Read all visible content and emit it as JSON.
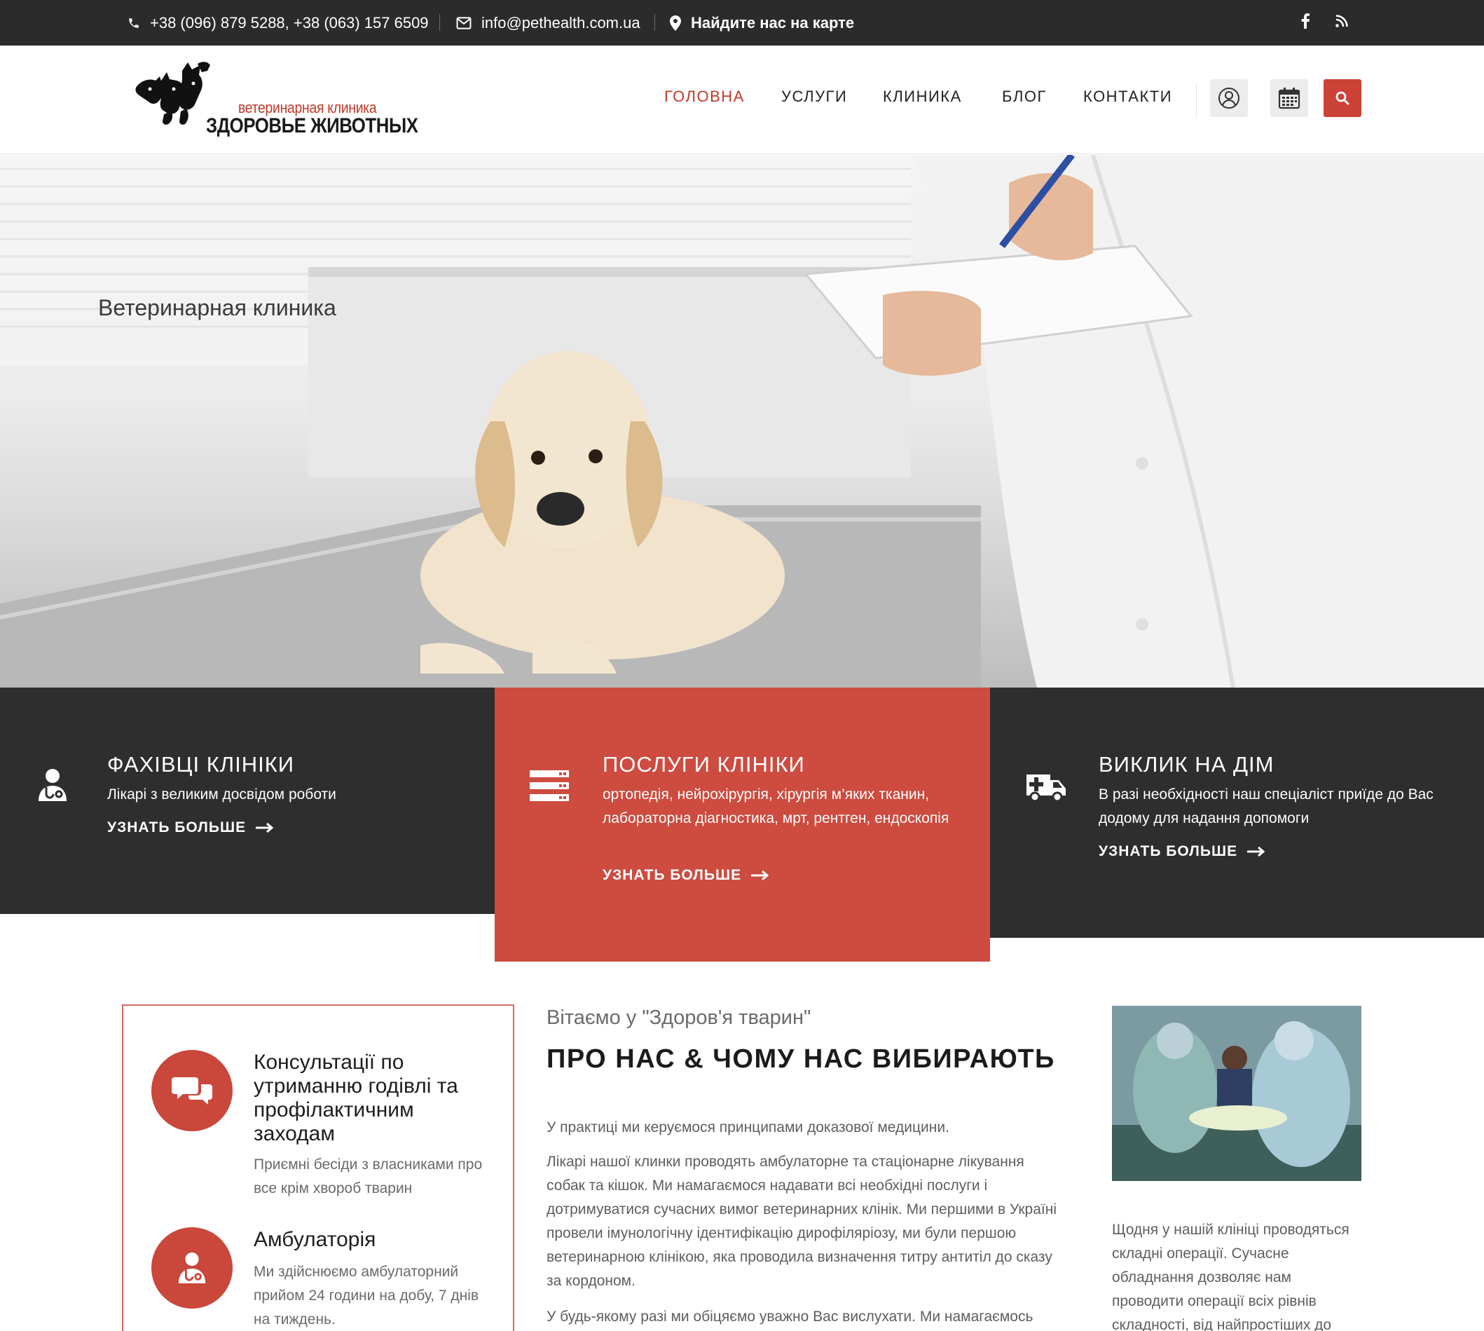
{
  "topbar": {
    "phones": "+38 (096) 879 5288, +38 (063) 157 6509",
    "email": "info@pethealth.com.ua",
    "map_link": "Найдите нас на карте",
    "social": [
      "facebook-icon",
      "rss-icon"
    ]
  },
  "header": {
    "logo_line1": "ветеринарная клиника",
    "logo_line2": "ЗДОРОВЬЕ ЖИВОТНЫХ",
    "nav": [
      "ГОЛОВНА",
      "УСЛУГИ",
      "КЛИНИКА",
      "БЛОГ",
      "КОНТАКТИ"
    ],
    "active_nav": "ГОЛОВНА",
    "buttons": [
      "user-icon",
      "calendar-icon",
      "search-icon"
    ]
  },
  "hero": {
    "title": "Ветеринарная клиника"
  },
  "features": [
    {
      "title": "ФАХІВЦІ КЛІНІКИ",
      "text": "Лікарі з великим досвідом роботи",
      "more": "УЗНАТЬ БОЛЬШЕ",
      "icon": "doctor-icon"
    },
    {
      "title": "ПОСЛУГИ КЛІНІКИ",
      "text": "ортопедія, нейрохірургія,  хірургія м’яких тканин, лабораторна діагностика, мрт, рентген, ендоскопія",
      "more": "УЗНАТЬ БОЛЬШЕ",
      "icon": "server-list-icon"
    },
    {
      "title": "ВИКЛИК НА ДІМ",
      "text": "В разі необхідності наш спеціаліст приїде до Вас додому для надання допомоги",
      "more": "УЗНАТЬ БОЛЬШЕ",
      "icon": "ambulance-icon"
    }
  ],
  "services": [
    {
      "title": "Консультації по утриманню годівлі та профілактичним заходам",
      "text": "Приємні бесіди з власниками про все крім хвороб тварин",
      "icon": "chat-bubbles-icon"
    },
    {
      "title": "Амбулаторія",
      "text": "Ми здійснюємо амбулаторний прийом 24 години на добу, 7 днів на тиждень.",
      "icon": "doctor-icon"
    }
  ],
  "about": {
    "welcome": "Вітаємо у \"Здоров'я тварин\"",
    "title": "ПРО НАС & ЧОМУ НАС ВИБИРАЮТЬ",
    "p1": "У практиці ми керуємося принципами доказової медицини.",
    "p2": "Лікарі нашої клинки проводять амбулаторне та стаціонарне лікування собак та кішок. Ми намагаємося надавати всі необхідні послуги і дотримуватися сучасних вимог ветеринарних клінік. Ми першими в Україні провели імунологічну ідентифікацію дирофіляріозу, ми були першою ветеринарною клінікою, яка проводила визначення титру антитіл до сказу за кордоном.",
    "p3": "У будь-якому разі ми обіцяємо уважно Вас вислухати. Ми намагаємось"
  },
  "side": {
    "text": "Щодня у нашій клініці проводяться складні операції. Сучасне обладнання дозволяє нам проводити операції всіх рівнів складності, від найпростіших до"
  },
  "colors": {
    "accent": "#cc4236",
    "dark": "#2b2b2b"
  }
}
